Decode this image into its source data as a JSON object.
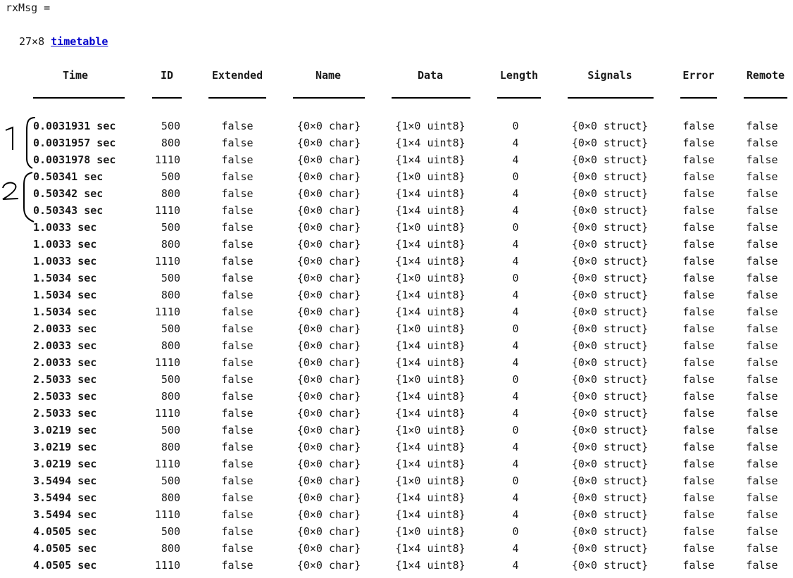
{
  "var_name": "rxMsg =",
  "size_text": "27×8",
  "type_link": "timetable",
  "headers": [
    "Time",
    "ID",
    "Extended",
    "Name",
    "Data",
    "Length",
    "Signals",
    "Error",
    "Remote"
  ],
  "annotations": [
    "1",
    "2"
  ],
  "rows": [
    [
      "0.0031931 sec",
      "500",
      "false",
      "{0×0 char}",
      "{1×0 uint8}",
      "0",
      "{0×0 struct}",
      "false",
      "false"
    ],
    [
      "0.0031957 sec",
      "800",
      "false",
      "{0×0 char}",
      "{1×4 uint8}",
      "4",
      "{0×0 struct}",
      "false",
      "false"
    ],
    [
      "0.0031978 sec",
      "1110",
      "false",
      "{0×0 char}",
      "{1×4 uint8}",
      "4",
      "{0×0 struct}",
      "false",
      "false"
    ],
    [
      "0.50341 sec",
      "500",
      "false",
      "{0×0 char}",
      "{1×0 uint8}",
      "0",
      "{0×0 struct}",
      "false",
      "false"
    ],
    [
      "0.50342 sec",
      "800",
      "false",
      "{0×0 char}",
      "{1×4 uint8}",
      "4",
      "{0×0 struct}",
      "false",
      "false"
    ],
    [
      "0.50343 sec",
      "1110",
      "false",
      "{0×0 char}",
      "{1×4 uint8}",
      "4",
      "{0×0 struct}",
      "false",
      "false"
    ],
    [
      "1.0033 sec",
      "500",
      "false",
      "{0×0 char}",
      "{1×0 uint8}",
      "0",
      "{0×0 struct}",
      "false",
      "false"
    ],
    [
      "1.0033 sec",
      "800",
      "false",
      "{0×0 char}",
      "{1×4 uint8}",
      "4",
      "{0×0 struct}",
      "false",
      "false"
    ],
    [
      "1.0033 sec",
      "1110",
      "false",
      "{0×0 char}",
      "{1×4 uint8}",
      "4",
      "{0×0 struct}",
      "false",
      "false"
    ],
    [
      "1.5034 sec",
      "500",
      "false",
      "{0×0 char}",
      "{1×0 uint8}",
      "0",
      "{0×0 struct}",
      "false",
      "false"
    ],
    [
      "1.5034 sec",
      "800",
      "false",
      "{0×0 char}",
      "{1×4 uint8}",
      "4",
      "{0×0 struct}",
      "false",
      "false"
    ],
    [
      "1.5034 sec",
      "1110",
      "false",
      "{0×0 char}",
      "{1×4 uint8}",
      "4",
      "{0×0 struct}",
      "false",
      "false"
    ],
    [
      "2.0033 sec",
      "500",
      "false",
      "{0×0 char}",
      "{1×0 uint8}",
      "0",
      "{0×0 struct}",
      "false",
      "false"
    ],
    [
      "2.0033 sec",
      "800",
      "false",
      "{0×0 char}",
      "{1×4 uint8}",
      "4",
      "{0×0 struct}",
      "false",
      "false"
    ],
    [
      "2.0033 sec",
      "1110",
      "false",
      "{0×0 char}",
      "{1×4 uint8}",
      "4",
      "{0×0 struct}",
      "false",
      "false"
    ],
    [
      "2.5033 sec",
      "500",
      "false",
      "{0×0 char}",
      "{1×0 uint8}",
      "0",
      "{0×0 struct}",
      "false",
      "false"
    ],
    [
      "2.5033 sec",
      "800",
      "false",
      "{0×0 char}",
      "{1×4 uint8}",
      "4",
      "{0×0 struct}",
      "false",
      "false"
    ],
    [
      "2.5033 sec",
      "1110",
      "false",
      "{0×0 char}",
      "{1×4 uint8}",
      "4",
      "{0×0 struct}",
      "false",
      "false"
    ],
    [
      "3.0219 sec",
      "500",
      "false",
      "{0×0 char}",
      "{1×0 uint8}",
      "0",
      "{0×0 struct}",
      "false",
      "false"
    ],
    [
      "3.0219 sec",
      "800",
      "false",
      "{0×0 char}",
      "{1×4 uint8}",
      "4",
      "{0×0 struct}",
      "false",
      "false"
    ],
    [
      "3.0219 sec",
      "1110",
      "false",
      "{0×0 char}",
      "{1×4 uint8}",
      "4",
      "{0×0 struct}",
      "false",
      "false"
    ],
    [
      "3.5494 sec",
      "500",
      "false",
      "{0×0 char}",
      "{1×0 uint8}",
      "0",
      "{0×0 struct}",
      "false",
      "false"
    ],
    [
      "3.5494 sec",
      "800",
      "false",
      "{0×0 char}",
      "{1×4 uint8}",
      "4",
      "{0×0 struct}",
      "false",
      "false"
    ],
    [
      "3.5494 sec",
      "1110",
      "false",
      "{0×0 char}",
      "{1×4 uint8}",
      "4",
      "{0×0 struct}",
      "false",
      "false"
    ],
    [
      "4.0505 sec",
      "500",
      "false",
      "{0×0 char}",
      "{1×0 uint8}",
      "0",
      "{0×0 struct}",
      "false",
      "false"
    ],
    [
      "4.0505 sec",
      "800",
      "false",
      "{0×0 char}",
      "{1×4 uint8}",
      "4",
      "{0×0 struct}",
      "false",
      "false"
    ],
    [
      "4.0505 sec",
      "1110",
      "false",
      "{0×0 char}",
      "{1×4 uint8}",
      "4",
      "{0×0 struct}",
      "false",
      "false"
    ]
  ]
}
